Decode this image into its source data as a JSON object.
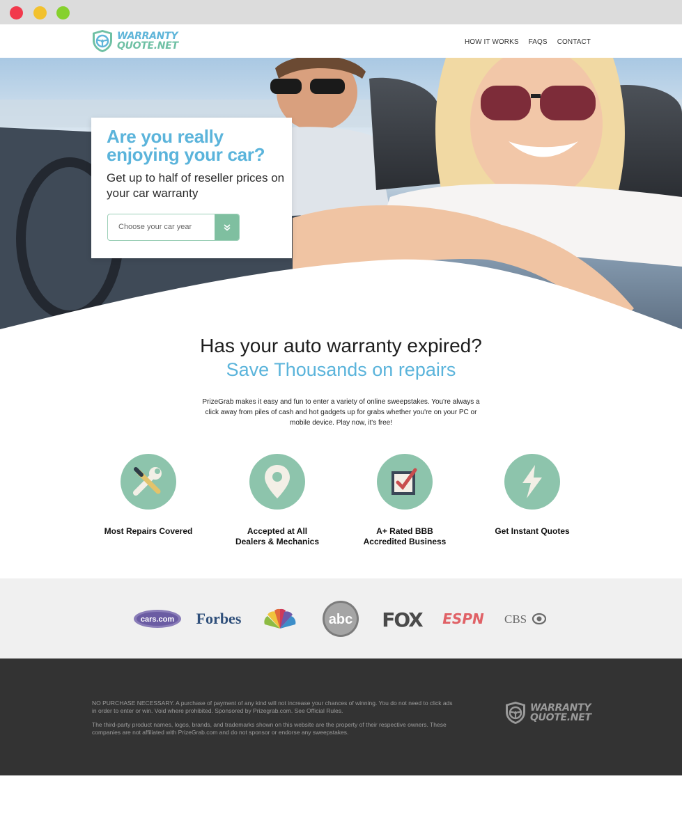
{
  "window": {
    "controls": [
      "close",
      "minimize",
      "maximize"
    ]
  },
  "brand": {
    "logo_line1": "WARRANTY",
    "logo_line2": "QUOTE.NET",
    "logo_icon": "steering-wheel-shield-icon"
  },
  "nav": {
    "items": [
      "HOW IT WORKS",
      "FAQS",
      "CONTACT"
    ]
  },
  "hero": {
    "title": "Are you really enjoying your car?",
    "subtitle": "Get up to half of reseller prices on your car warranty",
    "select": {
      "placeholder": "Choose your car year",
      "icon": "double-chevron-down-icon"
    }
  },
  "section": {
    "title": "Has your auto warranty expired?",
    "subtitle": "Save Thousands on repairs",
    "body": "PrizeGrab makes it easy and fun to enter a variety of online sweepstakes. You're always a click away from piles of cash and hot gadgets up for grabs whether you're on your PC or mobile device. Play now, it's free!"
  },
  "features": [
    {
      "icon": "tools-icon",
      "label": "Most Repairs Covered"
    },
    {
      "icon": "map-pin-icon",
      "label": "Accepted at All\nDealers & Mechanics"
    },
    {
      "icon": "checkbox-icon",
      "label": "A+ Rated BBB\nAccredited Business"
    },
    {
      "icon": "lightning-icon",
      "label": "Get Instant Quotes"
    }
  ],
  "press_logos": [
    "cars.com",
    "Forbes",
    "NBC",
    "abc",
    "FOX",
    "ESPN",
    "CBS"
  ],
  "footer": {
    "legal1": "NO PURCHASE NECESSARY. A purchase of payment of any kind will not increase your chances of winning. You do not need to click ads in order to enter or win. Void where prohibited. Sponsored by Prizegrab.com. See Official Rules.",
    "legal2": "The third-party product names, logos, brands, and trademarks shown on this website are the property of their respective owners. These companies are not affiliated with PrizeGrab.com and do not sponsor or endorse any sweepstakes."
  },
  "colors": {
    "accent_blue": "#5bb4db",
    "accent_green": "#8dc4ac",
    "footer_bg": "#333333",
    "press_bg": "#f0f0f0"
  }
}
